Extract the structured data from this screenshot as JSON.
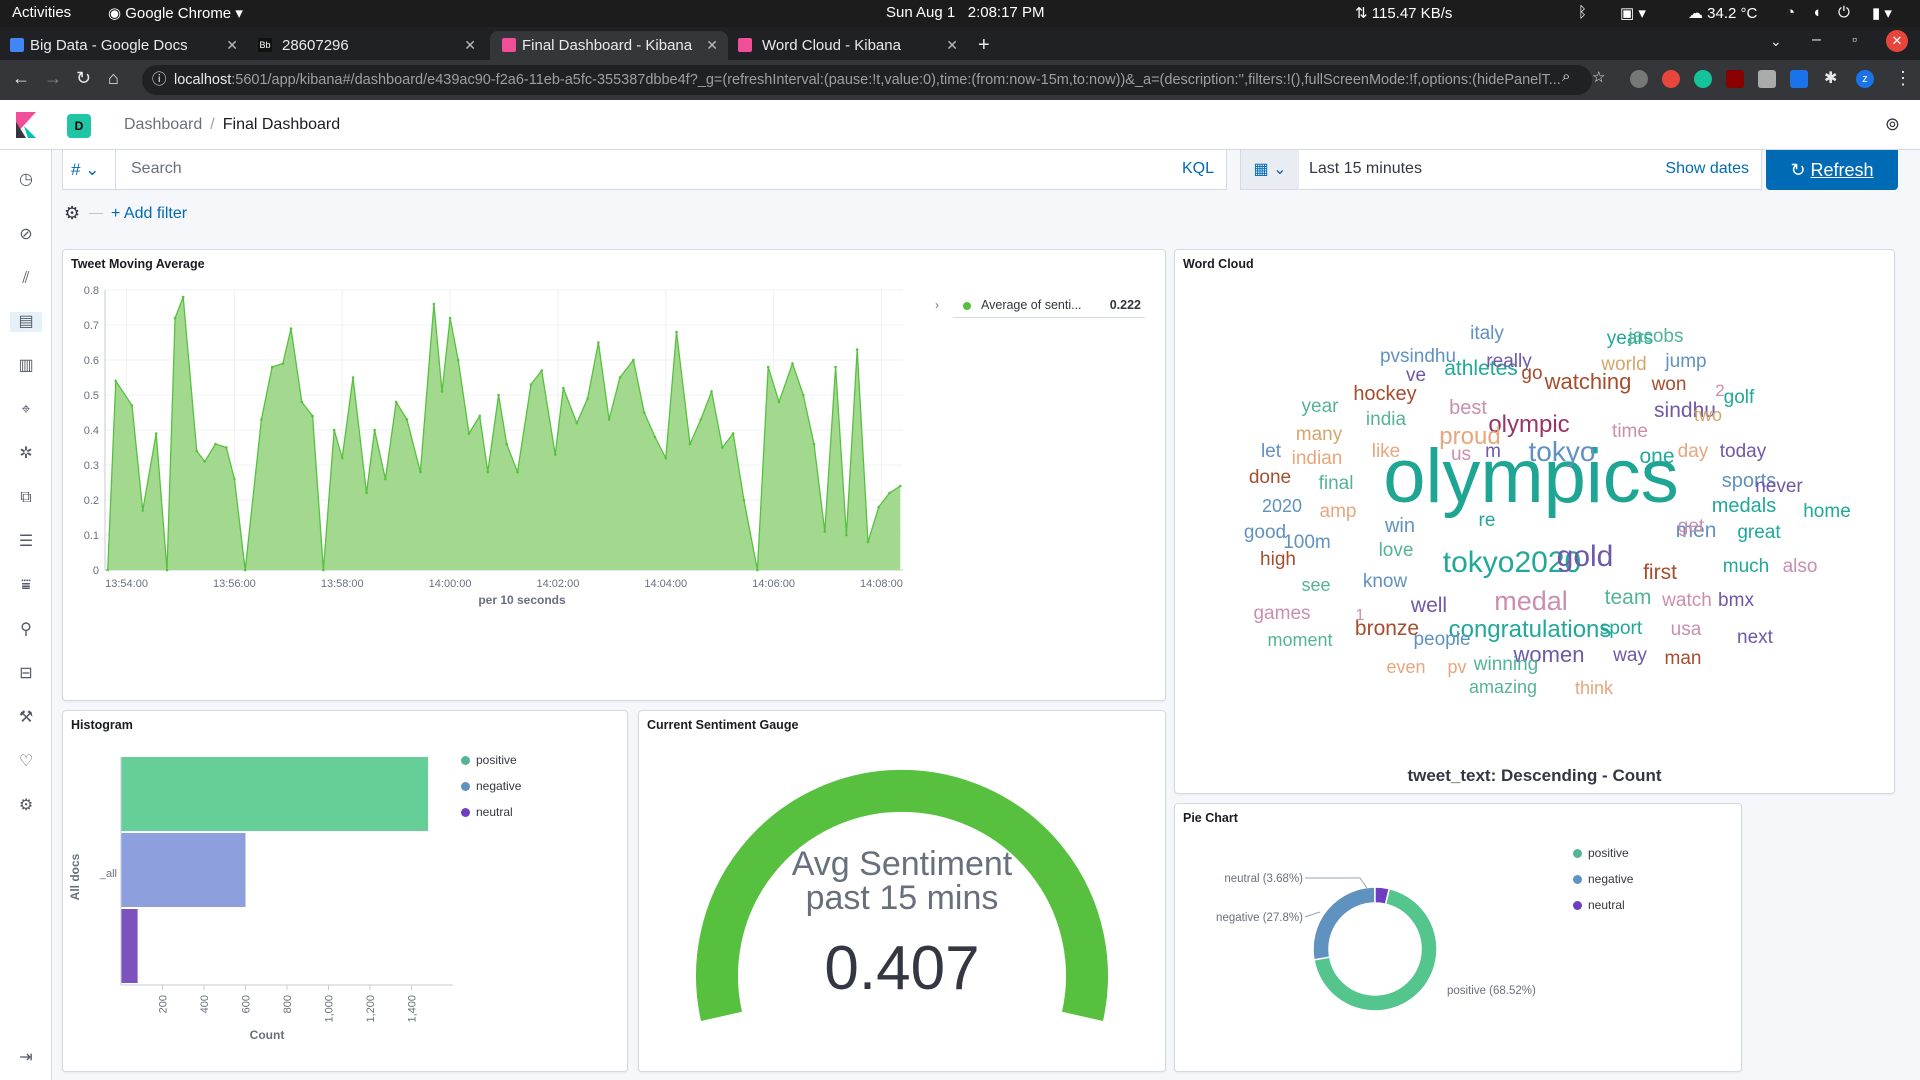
{
  "os": {
    "activities": "Activities",
    "app": "Google Chrome",
    "clock": "Sun Aug 1   2:08:17 PM",
    "net": "115.47 KB/s",
    "temp": "34.2 °C"
  },
  "tabs": [
    {
      "title": "Big Data - Google Docs",
      "color": "#4285f4"
    },
    {
      "title": "28607296",
      "color": "#333"
    },
    {
      "title": "Final Dashboard - Kibana",
      "color": "#f04e98"
    },
    {
      "title": "Word Cloud - Kibana",
      "color": "#f04e98"
    }
  ],
  "url": {
    "host": "localhost",
    "rest": ":5601/app/kibana#/dashboard/e439ac90-f2a6-11eb-a5fc-355387dbbe4f?_g=(refreshInterval:(pause:!t,value:0),time:(from:now-15m,to:now))&_a=(description:'',filters:!(),fullScreenMode:!f,options:(hidePanelT..."
  },
  "breadcrumb": {
    "space": "D",
    "root": "Dashboard",
    "current": "Final Dashboard"
  },
  "query": {
    "placeholder": "Search",
    "lang": "KQL",
    "range": "Last 15 minutes",
    "show_dates": "Show dates",
    "refresh": "Refresh",
    "add_filter": "+ Add filter"
  },
  "panels": {
    "moving_avg": "Tweet Moving Average",
    "word_cloud": "Word Cloud",
    "histogram": "Histogram",
    "gauge": "Current Sentiment Gauge",
    "pie": "Pie Chart"
  },
  "colors": {
    "positive": "#54b399",
    "negative": "#6092c0",
    "neutral": "#9170b8",
    "area": "#a2d98e",
    "line": "#57c13f",
    "gauge": "#57c13f"
  },
  "chart_data": [
    {
      "type": "area",
      "title": "Tweet Moving Average",
      "xlabel": "per 10 seconds",
      "ylabel": "",
      "ylim": [
        0,
        0.8
      ],
      "yticks": [
        "0",
        "0.1",
        "0.2",
        "0.3",
        "0.4",
        "0.5",
        "0.6",
        "0.7",
        "0.8"
      ],
      "xticks": [
        "13:54:00",
        "13:56:00",
        "13:58:00",
        "14:00:00",
        "14:02:00",
        "14:04:00",
        "14:06:00",
        "14:08:00"
      ],
      "xticks_min": [
        0,
        2,
        4,
        6,
        8,
        10,
        12,
        14
      ],
      "xrange_min": [
        -0.4,
        14.4
      ],
      "series": [
        {
          "name": "Average of senti...",
          "legend_value": "0.222",
          "x_min": [
            -0.35,
            -0.2,
            0.1,
            0.3,
            0.55,
            0.75,
            0.9,
            1.05,
            1.3,
            1.45,
            1.65,
            1.85,
            2.0,
            2.2,
            2.5,
            2.7,
            2.9,
            3.05,
            3.25,
            3.45,
            3.65,
            3.85,
            4.0,
            4.2,
            4.45,
            4.6,
            4.8,
            5.0,
            5.2,
            5.45,
            5.7,
            5.85,
            6.0,
            6.15,
            6.35,
            6.55,
            6.7,
            6.9,
            7.05,
            7.25,
            7.5,
            7.7,
            7.95,
            8.1,
            8.35,
            8.55,
            8.75,
            8.95,
            9.15,
            9.4,
            9.6,
            9.8,
            10.0,
            10.2,
            10.45,
            10.65,
            10.85,
            11.05,
            11.25,
            11.45,
            11.7,
            11.9,
            12.1,
            12.35,
            12.55,
            12.75,
            12.95,
            13.15,
            13.35,
            13.55,
            13.75,
            13.95,
            14.15,
            14.35
          ],
          "y": [
            0,
            0.54,
            0.47,
            0.17,
            0.39,
            0,
            0.72,
            0.78,
            0.34,
            0.31,
            0.36,
            0.35,
            0.26,
            0,
            0.43,
            0.58,
            0.59,
            0.69,
            0.48,
            0.44,
            0,
            0.4,
            0.32,
            0.55,
            0.22,
            0.4,
            0.26,
            0.48,
            0.43,
            0.28,
            0.76,
            0.51,
            0.72,
            0.6,
            0.39,
            0.44,
            0.28,
            0.5,
            0.36,
            0.28,
            0.53,
            0.57,
            0.33,
            0.52,
            0.42,
            0.49,
            0.65,
            0.43,
            0.55,
            0.6,
            0.45,
            0.38,
            0.32,
            0.68,
            0.36,
            0.43,
            0.51,
            0.35,
            0.39,
            0.2,
            0,
            0.58,
            0.48,
            0.59,
            0.5,
            0.36,
            0.11,
            0.58,
            0.1,
            0.63,
            0.08,
            0.18,
            0.22,
            0.24
          ]
        }
      ]
    },
    {
      "type": "bar",
      "title": "Histogram",
      "orientation": "horizontal",
      "categories": [
        "_all"
      ],
      "xlabel": "Count",
      "ylabel": "All docs",
      "xticks": [
        "200",
        "400",
        "600",
        "800",
        "1,000",
        "1,200",
        "1,400"
      ],
      "xlim": [
        0,
        1600
      ],
      "series": [
        {
          "name": "positive",
          "values": [
            1480
          ]
        },
        {
          "name": "negative",
          "values": [
            600
          ]
        },
        {
          "name": "neutral",
          "values": [
            80
          ]
        }
      ]
    },
    {
      "type": "gauge",
      "title": "Current Sentiment Gauge",
      "label_line1": "Avg Sentiment",
      "label_line2": "past 15 mins",
      "value": "0.407"
    },
    {
      "type": "pie",
      "title": "Pie Chart",
      "series": [
        {
          "name": "positive",
          "value": 68.52,
          "label": "positive (68.52%)"
        },
        {
          "name": "negative",
          "value": 27.8,
          "label": "negative (27.8%)"
        },
        {
          "name": "neutral",
          "value": 3.68,
          "label": "neutral (3.68%)"
        }
      ]
    }
  ],
  "word_cloud": {
    "caption": "tweet_text: Descending - Count",
    "words": [
      {
        "t": "olympics",
        "c": "#1ea593"
      },
      {
        "t": "tokyo2020",
        "c": "#20a898"
      },
      {
        "t": "gold",
        "c": "#7057a8"
      },
      {
        "t": "tokyo",
        "c": "#6092c0"
      },
      {
        "t": "medal",
        "c": "#ca8eae"
      },
      {
        "t": "olympic",
        "c": "#9b3366"
      },
      {
        "t": "congratulations",
        "c": "#20a898"
      },
      {
        "t": "proud",
        "c": "#e7a67b"
      },
      {
        "t": "watching",
        "c": "#a64d2d"
      },
      {
        "t": "athletes",
        "c": "#20a898"
      },
      {
        "t": "team",
        "c": "#54b399"
      },
      {
        "t": "first",
        "c": "#a64d2d"
      },
      {
        "t": "one",
        "c": "#20a898"
      },
      {
        "t": "sports",
        "c": "#6092c0"
      },
      {
        "t": "medals",
        "c": "#20a898"
      },
      {
        "t": "women",
        "c": "#7057a8"
      },
      {
        "t": "bronze",
        "c": "#a64d2d"
      },
      {
        "t": "men",
        "c": "#6092c0"
      },
      {
        "t": "well",
        "c": "#7057a8"
      },
      {
        "t": "sindhu",
        "c": "#7057a8"
      },
      {
        "t": "hockey",
        "c": "#a64d2d"
      },
      {
        "t": "years",
        "c": "#20a898"
      },
      {
        "t": "jacobs",
        "c": "#54b399"
      },
      {
        "t": "italy",
        "c": "#6092c0"
      },
      {
        "t": "really",
        "c": "#7057a8"
      },
      {
        "t": "pvsindhu",
        "c": "#6092c0"
      },
      {
        "t": "world",
        "c": "#d6a56b"
      },
      {
        "t": "jump",
        "c": "#6092c0"
      },
      {
        "t": "go",
        "c": "#a64d2d"
      },
      {
        "t": "ve",
        "c": "#7057a8"
      },
      {
        "t": "won",
        "c": "#a64d2d"
      },
      {
        "t": "2",
        "c": "#ca8eae"
      },
      {
        "t": "golf",
        "c": "#20a898"
      },
      {
        "t": "best",
        "c": "#ca8eae"
      },
      {
        "t": "year",
        "c": "#54b399"
      },
      {
        "t": "india",
        "c": "#54b399"
      },
      {
        "t": "time",
        "c": "#ca8eae"
      },
      {
        "t": "two",
        "c": "#d6a56b"
      },
      {
        "t": "many",
        "c": "#d6a56b"
      },
      {
        "t": "let",
        "c": "#6092c0"
      },
      {
        "t": "indian",
        "c": "#e7a67b"
      },
      {
        "t": "like",
        "c": "#e7a67b"
      },
      {
        "t": "us",
        "c": "#ca8eae"
      },
      {
        "t": "m",
        "c": "#7057a8"
      },
      {
        "t": "day",
        "c": "#e7a67b"
      },
      {
        "t": "today",
        "c": "#7057a8"
      },
      {
        "t": "done",
        "c": "#a64d2d"
      },
      {
        "t": "final",
        "c": "#54b399"
      },
      {
        "t": "never",
        "c": "#7057a8"
      },
      {
        "t": "2020",
        "c": "#6092c0"
      },
      {
        "t": "amp",
        "c": "#e7a67b"
      },
      {
        "t": "home",
        "c": "#20a898"
      },
      {
        "t": "good",
        "c": "#6092c0"
      },
      {
        "t": "win",
        "c": "#6092c0"
      },
      {
        "t": "re",
        "c": "#20a898"
      },
      {
        "t": "get",
        "c": "#ca8eae"
      },
      {
        "t": "great",
        "c": "#20a898"
      },
      {
        "t": "100m",
        "c": "#6092c0"
      },
      {
        "t": "love",
        "c": "#54b399"
      },
      {
        "t": "high",
        "c": "#a64d2d"
      },
      {
        "t": "much",
        "c": "#20a898"
      },
      {
        "t": "also",
        "c": "#ca8eae"
      },
      {
        "t": "see",
        "c": "#54b399"
      },
      {
        "t": "know",
        "c": "#6092c0"
      },
      {
        "t": "watch",
        "c": "#ca8eae"
      },
      {
        "t": "bmx",
        "c": "#7057a8"
      },
      {
        "t": "games",
        "c": "#ca8eae"
      },
      {
        "t": "1",
        "c": "#ca8eae"
      },
      {
        "t": "usa",
        "c": "#ca8eae"
      },
      {
        "t": "sport",
        "c": "#20a898"
      },
      {
        "t": "next",
        "c": "#7057a8"
      },
      {
        "t": "moment",
        "c": "#54b399"
      },
      {
        "t": "people",
        "c": "#6092c0"
      },
      {
        "t": "man",
        "c": "#a64d2d"
      },
      {
        "t": "way",
        "c": "#7057a8"
      },
      {
        "t": "even",
        "c": "#e7a67b"
      },
      {
        "t": "pv",
        "c": "#e7a67b"
      },
      {
        "t": "winning",
        "c": "#54b399"
      },
      {
        "t": "amazing",
        "c": "#54b399"
      },
      {
        "t": "think",
        "c": "#e7a67b"
      }
    ]
  }
}
